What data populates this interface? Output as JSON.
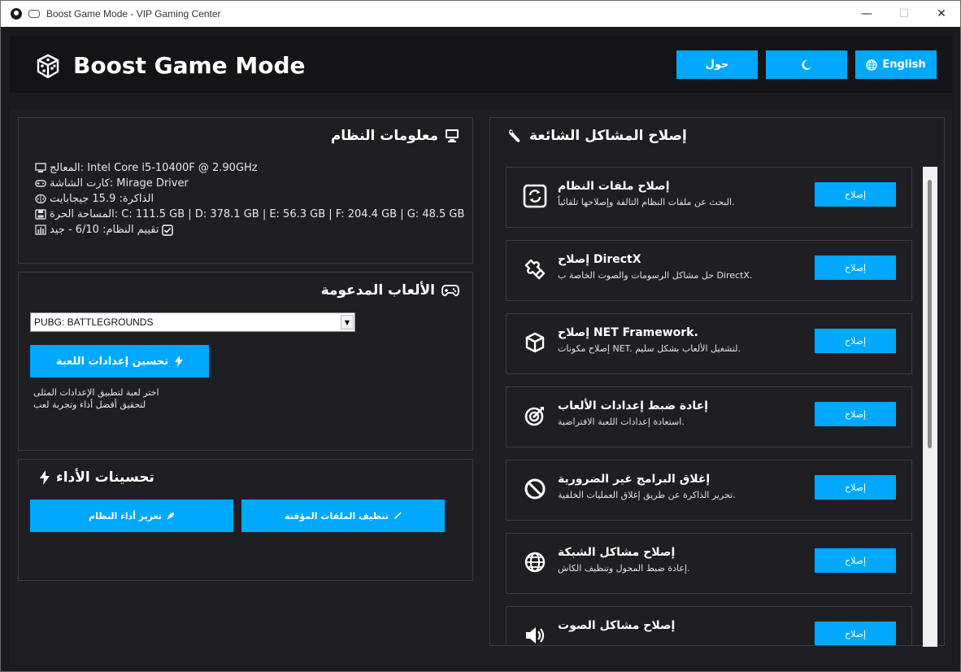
{
  "window": {
    "title": "Boost Game Mode - VIP Gaming Center",
    "minimize": "—",
    "maximize": "☐",
    "close": "✕"
  },
  "header": {
    "brand": "Boost Game Mode",
    "about_label": "حول",
    "lang_label": "English"
  },
  "system": {
    "title": "معلومات النظام",
    "rows": [
      "المعالج: Intel Core i5-10400F @ 2.90GHz",
      "كارت الشاشة: Mirage Driver",
      "الذاكرة: 15.9 جيجابايت",
      "المساحة الحرة: C: 111.5 GB | D: 378.1 GB | E: 56.3 GB | F: 204.4 GB | G: 48.5 GB",
      "تقييم النظام: 6/10 - جيد"
    ]
  },
  "games": {
    "title": "الألعاب المدعومة",
    "selected": "PUBG: BATTLEGROUNDS",
    "optimize_label": "تحسين إعدادات اللعبة",
    "hint_line1": "اختر لعبة لتطبيق الإعدادات المثلى",
    "hint_line2": "لتحقيق أفضل أداء وتجربة لعب"
  },
  "performance": {
    "title": "تحسينات الأداء",
    "boost_label": "تعزيز أداء النظام",
    "clean_label": "تنظيف الملفات المؤقتة"
  },
  "fixes": {
    "title": "إصلاح المشاكل الشائعة",
    "button_label": "إصلاح",
    "items": [
      {
        "title": "إصلاح ملفات النظام",
        "desc": "البحث عن ملفات النظام التالفة وإصلاحها تلقائياً.",
        "icon": "system-files-icon"
      },
      {
        "title": "إصلاح DirectX",
        "desc": "حل مشاكل الرسومات والصوت الخاصة ب DirectX.",
        "icon": "puzzle-icon"
      },
      {
        "title": "إصلاح NET Framework.",
        "desc": "إصلاح مكونات NET. لتشغيل الألعاب بشكل سليم.",
        "icon": "cube-icon"
      },
      {
        "title": "إعادة ضبط إعدادات الألعاب",
        "desc": "استعادة إعدادات اللعبة الافتراضية.",
        "icon": "target-icon"
      },
      {
        "title": "إغلاق البرامج غير الضرورية",
        "desc": "تحرير الذاكرة عن طريق إغلاق العمليات الخلفية.",
        "icon": "block-icon"
      },
      {
        "title": "إصلاح مشاكل الشبكة",
        "desc": "إعادة ضبط المحول وتنظيف الكاش.",
        "icon": "globe-icon"
      },
      {
        "title": "إصلاح مشاكل الصوت",
        "desc": "",
        "icon": "speaker-icon"
      }
    ]
  },
  "colors": {
    "accent": "#00a8ff",
    "background": "#1b1b1f",
    "panel": "#1f1f23"
  }
}
